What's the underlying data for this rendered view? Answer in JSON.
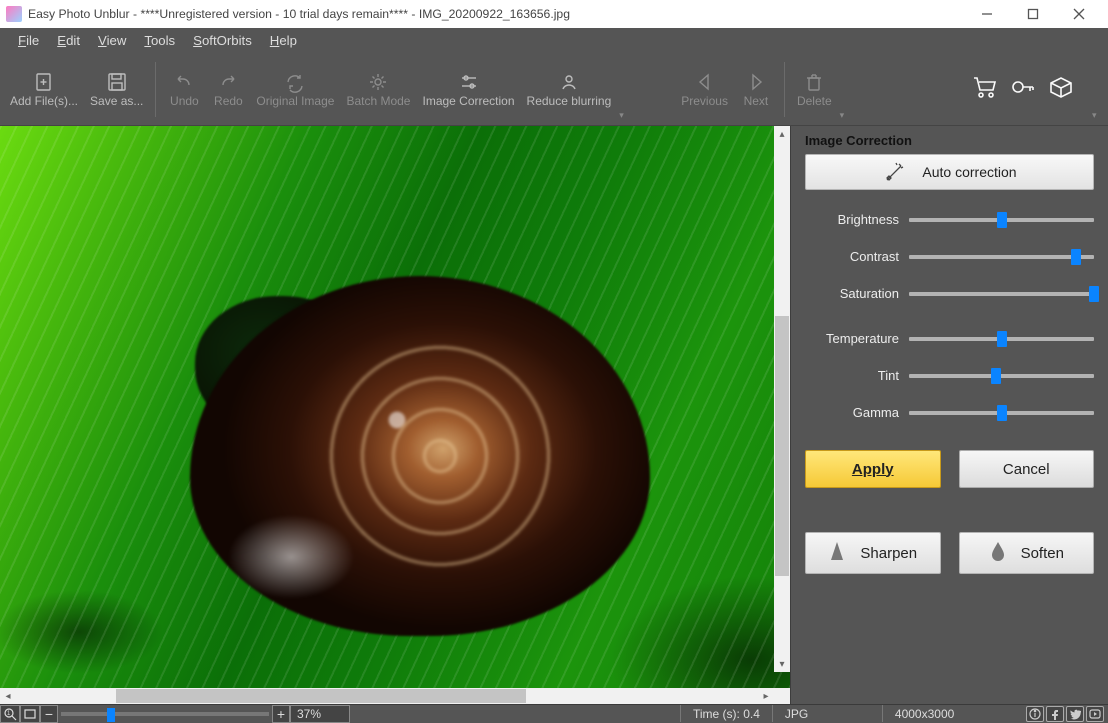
{
  "title": "Easy Photo Unblur - ****Unregistered version - 10 trial days remain**** - IMG_20200922_163656.jpg",
  "menu": {
    "file": "File",
    "edit": "Edit",
    "view": "View",
    "tools": "Tools",
    "softorbits": "SoftOrbits",
    "help": "Help"
  },
  "toolbar": {
    "add": "Add File(s)...",
    "save": "Save as...",
    "undo": "Undo",
    "redo": "Redo",
    "original": "Original Image",
    "batch": "Batch Mode",
    "correction": "Image Correction",
    "reduce": "Reduce blurring",
    "previous": "Previous",
    "next": "Next",
    "delete": "Delete"
  },
  "panel": {
    "title": "Image Correction",
    "auto": "Auto correction",
    "sliders": {
      "brightness": {
        "label": "Brightness",
        "pct": 50
      },
      "contrast": {
        "label": "Contrast",
        "pct": 90
      },
      "saturation": {
        "label": "Saturation",
        "pct": 100
      },
      "temperature": {
        "label": "Temperature",
        "pct": 50
      },
      "tint": {
        "label": "Tint",
        "pct": 47
      },
      "gamma": {
        "label": "Gamma",
        "pct": 50
      }
    },
    "apply": "Apply",
    "cancel": "Cancel",
    "sharpen": "Sharpen",
    "soften": "Soften"
  },
  "status": {
    "zoom": "37%",
    "time": "Time (s): 0.4",
    "fmt": "JPG",
    "dims": "4000x3000"
  }
}
